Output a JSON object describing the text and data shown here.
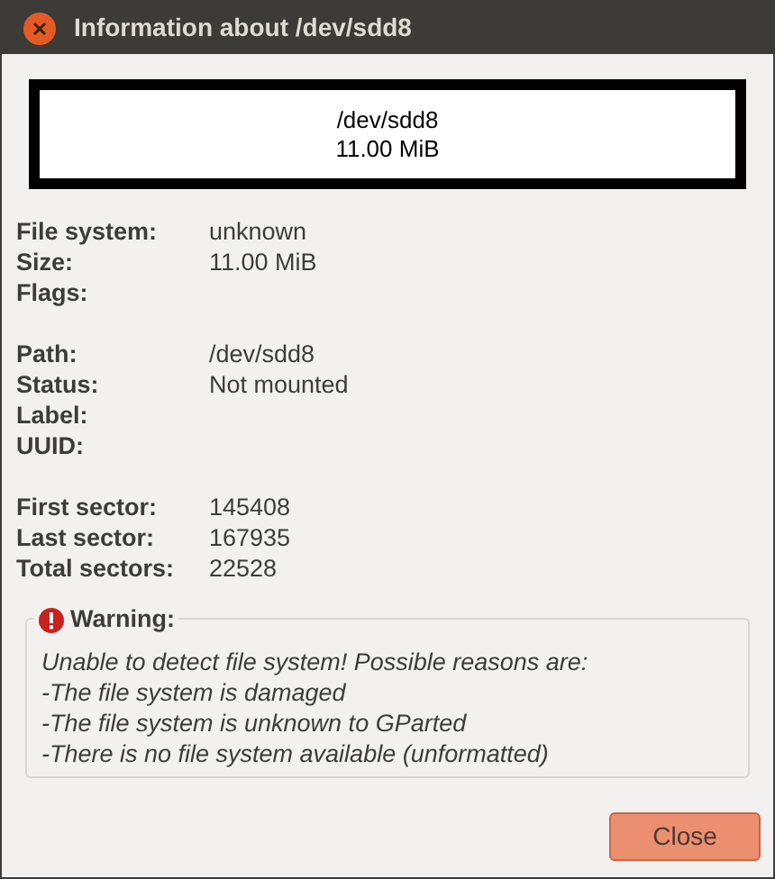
{
  "window": {
    "title": "Information about /dev/sdd8"
  },
  "partition_graphic": {
    "path": "/dev/sdd8",
    "size": "11.00 MiB"
  },
  "sections": [
    {
      "fields": [
        {
          "label": "File system:",
          "value": "unknown"
        },
        {
          "label": "Size:",
          "value": "11.00 MiB"
        },
        {
          "label": "Flags:"
        }
      ]
    },
    {
      "fields": [
        {
          "label": "Path:",
          "value": "/dev/sdd8"
        },
        {
          "label": "Status:",
          "value": "Not mounted"
        },
        {
          "label": "Label:"
        },
        {
          "label": "UUID:"
        }
      ]
    },
    {
      "fields": [
        {
          "label": "First sector:",
          "value": "145408"
        },
        {
          "label": "Last sector:",
          "value": "167935"
        },
        {
          "label": "Total sectors:",
          "value": "22528"
        }
      ]
    }
  ],
  "warning": {
    "title": "Warning:",
    "lines": [
      "Unable to detect file system! Possible reasons are:",
      "-The file system is damaged",
      "-The file system is unknown to GParted",
      "-There is no file system available (unformatted)"
    ]
  },
  "buttons": [
    {
      "label": "Close"
    }
  ]
}
